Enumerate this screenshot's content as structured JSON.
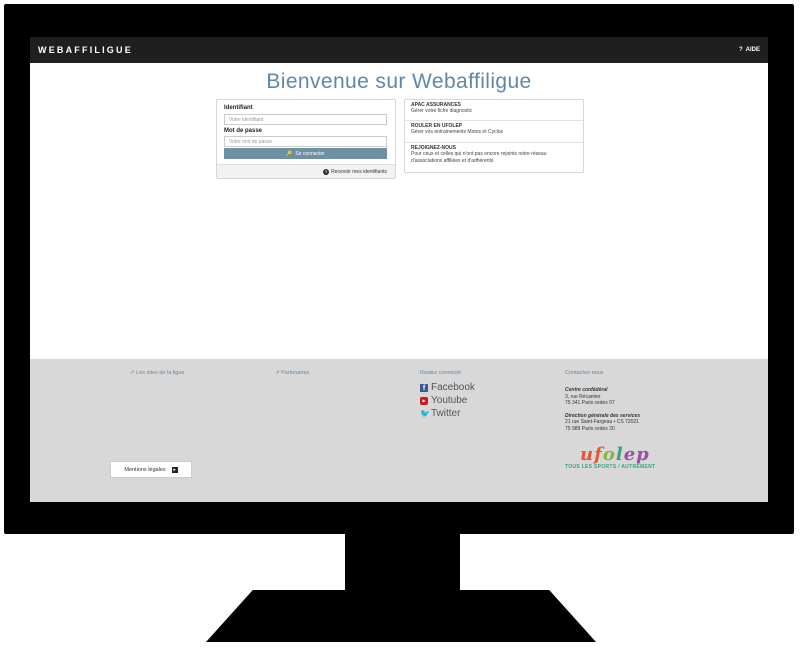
{
  "topbar": {
    "brand": "WEBAFFILIGUE",
    "help_label": "AIDE"
  },
  "page": {
    "title": "Bienvenue sur Webaffiligue"
  },
  "login": {
    "id_label": "Identifiant",
    "id_placeholder": "Votre identifiant",
    "pw_label": "Mot de passe",
    "pw_placeholder": "Votre mot de passe",
    "submit_label": "Se connecter",
    "recover_label": "Recevoir mes identifiants"
  },
  "links": [
    {
      "title": "APAC ASSURANCES",
      "desc": "Gérer votre fiche diagnostic"
    },
    {
      "title": "ROULER EN UFOLEP",
      "desc": "Gérer vos entrainements Motos et Cyclos"
    },
    {
      "title": "REJOIGNEZ-NOUS",
      "desc": "Pour ceux et celles qui n'ont pas encore rejoints notre réseau d'associations affiliées et d'adhérents"
    }
  ],
  "footer": {
    "sites_label": "Les sites de la ligue",
    "partners_label": "Partenaires",
    "connect_label": "Restez connecté",
    "contact_label": "Contactez-nous",
    "social": [
      "Facebook",
      "Youtube",
      "Twitter"
    ],
    "address1_title": "Centre confédéral",
    "address1_line1": "3, rue Récamier",
    "address1_line2": "75 341 Paris cedex 07",
    "address2_title": "Direction générale des services",
    "address2_line1": "21 rue Saint-Fargeau • CS 72021",
    "address2_line2": "75 989 Paris cedex 20",
    "logo_text": "ufolep",
    "logo_tagline_a": "TOUS LES SPORTS",
    "logo_tagline_b": "AUTREMENT",
    "mentions_label": "Mentions légales"
  },
  "colors": {
    "accent": "#5f88a8",
    "button": "#6f8fa3",
    "topbar": "#1f1f1f",
    "footer_bg": "#d8d8d8"
  }
}
